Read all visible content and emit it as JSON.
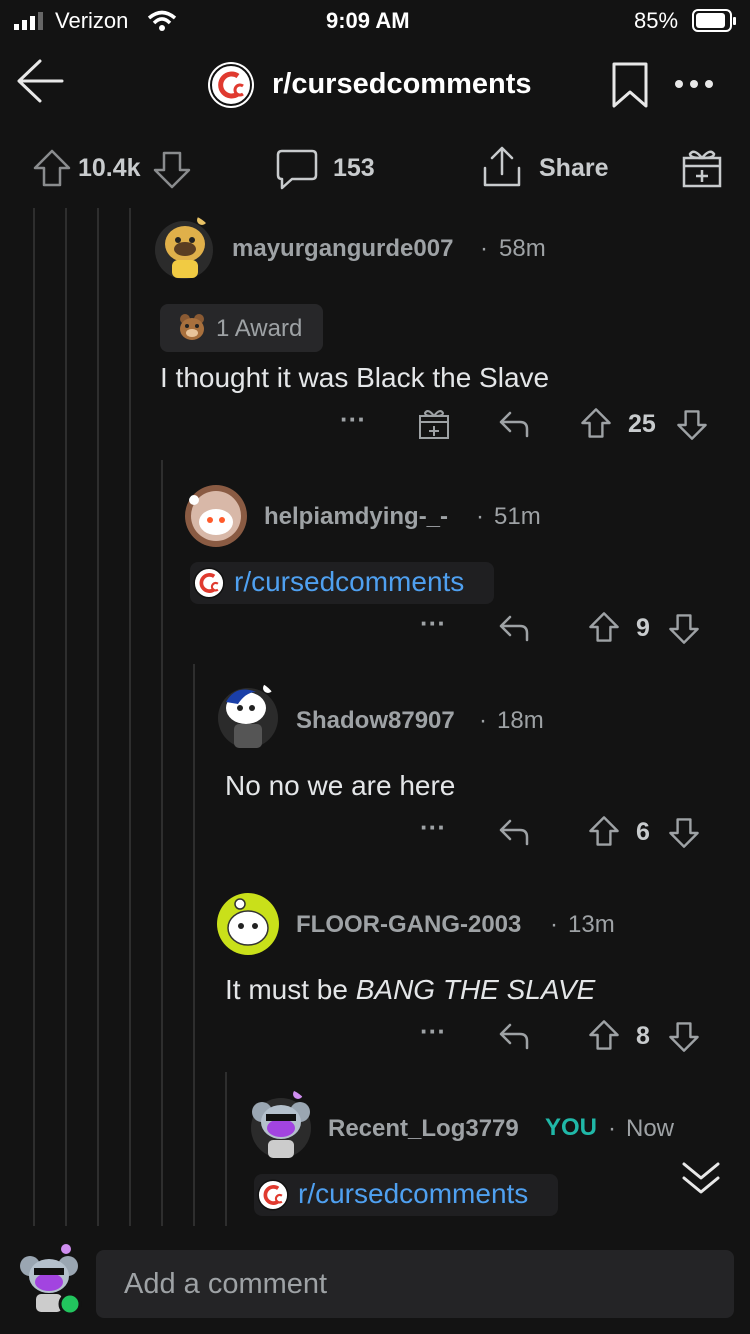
{
  "status_bar": {
    "carrier": "Verizon",
    "time": "9:09 AM",
    "battery": "85%"
  },
  "header": {
    "subreddit": "r/cursedcomments",
    "back_icon": "arrow-left-icon",
    "bookmark_icon": "bookmark-icon",
    "more_icon": "more-horizontal-icon"
  },
  "actions": {
    "upvotes": "10.4k",
    "comments": "153",
    "share": "Share"
  },
  "comments": [
    {
      "user": "mayurgangurde007",
      "sep": "·",
      "time": "58m",
      "award": "1 Award",
      "body": "I thought it was Black the Slave",
      "votes": "25",
      "more": "···"
    },
    {
      "user": "helpiamdying-_-",
      "sep": "·",
      "time": "51m",
      "link": "r/cursedcomments",
      "votes": "9",
      "more": "···"
    },
    {
      "user": "Shadow87907",
      "sep": "·",
      "time": "18m",
      "body": "No no we are here",
      "votes": "6",
      "more": "···"
    },
    {
      "user": "FLOOR-GANG-2003",
      "sep": "·",
      "time": "13m",
      "body_plain": "It must be ",
      "body_em": "BANG THE SLAVE",
      "votes": "8",
      "more": "···"
    },
    {
      "user": "Recent_Log3779",
      "you": "YOU",
      "sep": "·",
      "time": "Now",
      "link": "r/cursedcomments"
    }
  ],
  "composer": {
    "placeholder": "Add a comment"
  },
  "colors": {
    "background": "#131313",
    "link": "#4fa0f0",
    "you_badge": "#20b8a8",
    "subreddit_logo_red": "#e03a2f"
  }
}
